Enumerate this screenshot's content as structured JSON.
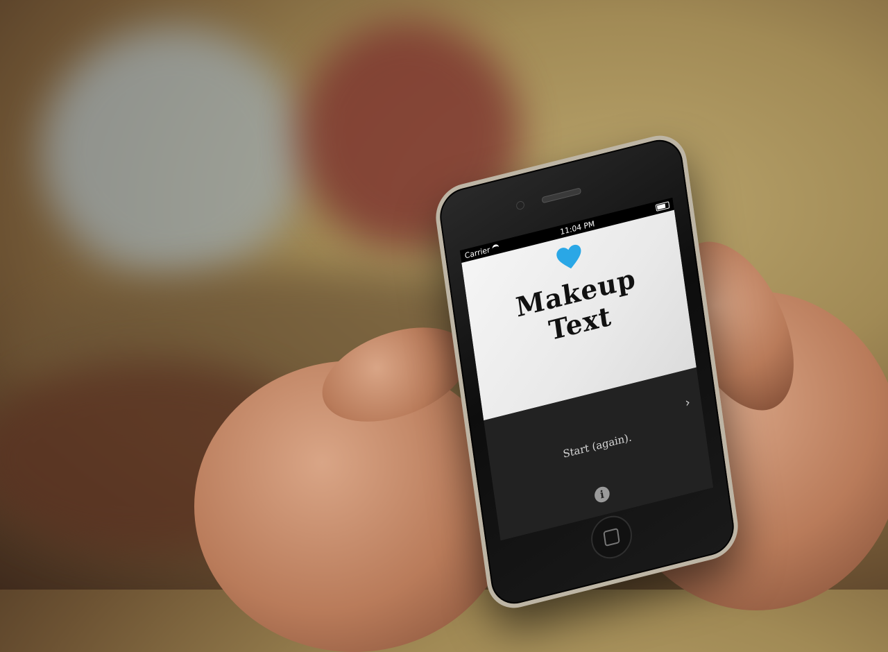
{
  "status_bar": {
    "carrier": "Carrier",
    "time": "11:04 PM"
  },
  "card": {
    "title_line1": "Makeup",
    "title_line2": "Text",
    "heart_color": "#2aa7e6"
  },
  "menu": {
    "start_label": "Start (again).",
    "chevron": "›",
    "info_icon": "i"
  }
}
